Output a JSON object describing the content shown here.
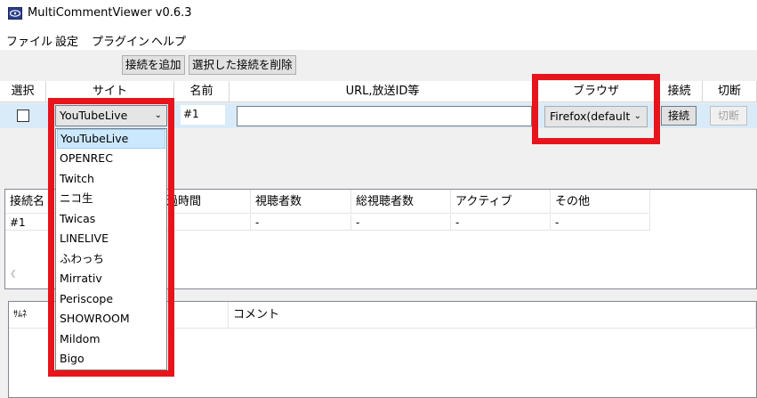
{
  "window": {
    "title": "MultiCommentViewer v0.6.3"
  },
  "menu": [
    "ファイル",
    "設定",
    "プラグイン",
    "ヘルプ"
  ],
  "toolbar": {
    "add_label": "接続を追加",
    "remove_label": "選択した接続を削除"
  },
  "connections": {
    "headers": [
      "選択",
      "サイト",
      "名前",
      "URL,放送ID等",
      "ブラウザ",
      "接続",
      "切断"
    ],
    "row": {
      "selected": false,
      "site": "YouTubeLive",
      "name": "#1",
      "url": "",
      "browser": "Firefox(default",
      "connect_label": "接続",
      "disconnect_label": "切断"
    }
  },
  "site_options": [
    "YouTubeLive",
    "OPENREC",
    "Twitch",
    "ニコ生",
    "Twicas",
    "LINELIVE",
    "ふわっち",
    "Mirrativ",
    "Periscope",
    "SHOWROOM",
    "Mildom",
    "Bigo"
  ],
  "status_list": {
    "headers": [
      "接続名",
      "過時間",
      "視聴者数",
      "総視聴者数",
      "アクティブ",
      "その他"
    ],
    "row": [
      "#1",
      "",
      "-",
      "-",
      "-",
      "-"
    ]
  },
  "comment_list": {
    "headers": [
      "ｻﾑﾈ",
      "",
      "コメント"
    ]
  },
  "colors": {
    "highlight": "#e8141b",
    "row_selected": "#d9ebf9",
    "dropdown_selected": "#cce8ff"
  },
  "icons": {
    "app": "app-logo-icon",
    "dropdown": "chevron-down-icon"
  }
}
